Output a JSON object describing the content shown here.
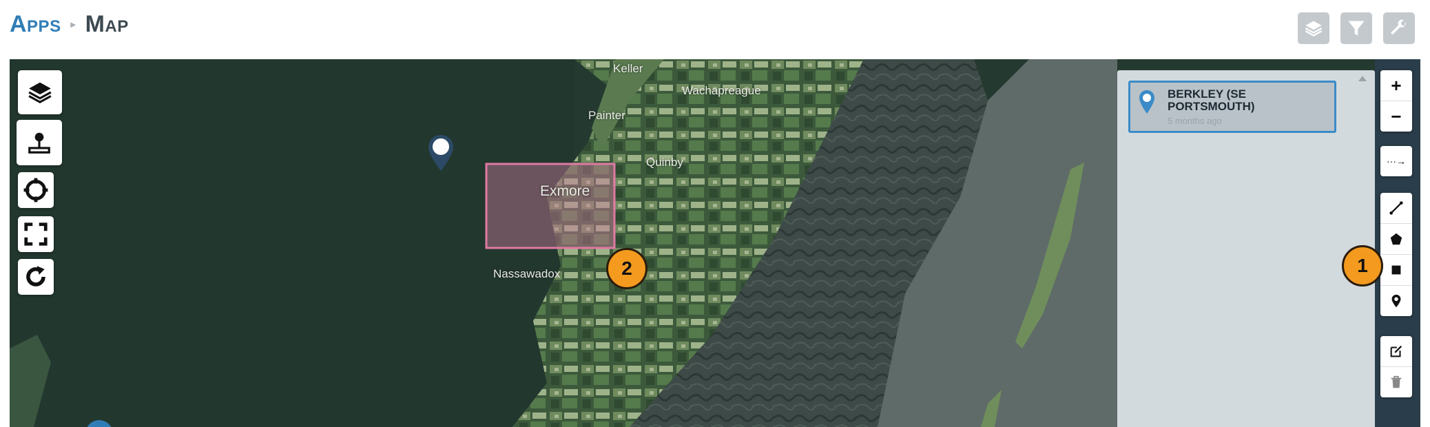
{
  "breadcrumb": {
    "apps": "Apps",
    "separator": "▸",
    "current": "Map"
  },
  "header_tools": [
    {
      "name": "layers-tool-icon"
    },
    {
      "name": "filter-icon"
    },
    {
      "name": "wrench-icon"
    }
  ],
  "map": {
    "place_labels": {
      "keller": "Keller",
      "wachapreague": "Wachapreague",
      "painter": "Painter",
      "quinby": "Quinby",
      "exmore": "Exmore",
      "nassawadox": "Nassawadox"
    },
    "selection_box_color": "#d9708f",
    "marker_color": "#2c4a66"
  },
  "left_controls": [
    {
      "name": "layers-icon"
    },
    {
      "name": "joystick-icon"
    },
    {
      "name": "crosshair-icon"
    },
    {
      "name": "fullscreen-icon"
    },
    {
      "name": "refresh-icon"
    }
  ],
  "results_panel": {
    "items": [
      {
        "title": "BERKLEY (SE PORTSMOUTH)",
        "time": "5 months ago"
      }
    ]
  },
  "zoom": {
    "in": "+",
    "out": "−"
  },
  "draw_tools": {
    "route": "···→"
  },
  "callouts": {
    "one": "1",
    "two": "2"
  },
  "colors": {
    "accent": "#2f7db6",
    "callout": "#f39a1f",
    "panel": "#d3dadd",
    "card_border": "#3a8bc8"
  }
}
